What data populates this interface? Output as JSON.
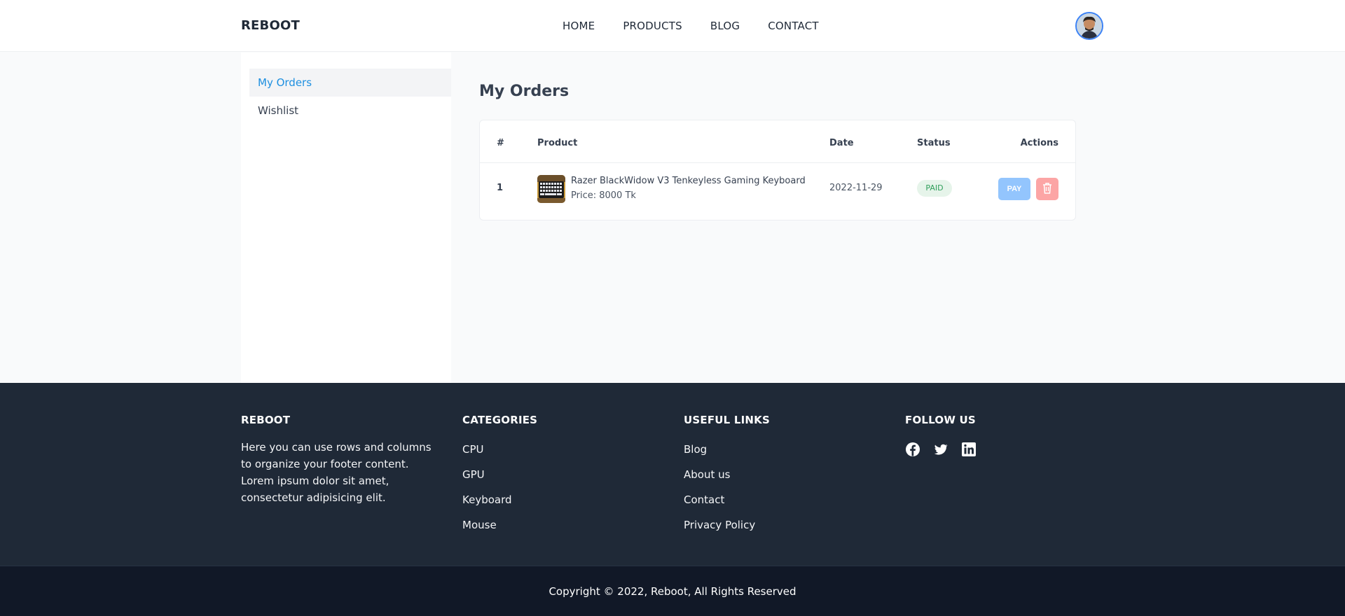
{
  "header": {
    "brand": "REBOOT",
    "nav": [
      "HOME",
      "PRODUCTS",
      "BLOG",
      "CONTACT"
    ]
  },
  "sidebar": {
    "items": [
      {
        "label": "My Orders",
        "active": true
      },
      {
        "label": "Wishlist",
        "active": false
      }
    ]
  },
  "main": {
    "title": "My Orders",
    "table": {
      "headers": [
        "#",
        "Product",
        "Date",
        "Status",
        "Actions"
      ],
      "rows": [
        {
          "index": "1",
          "product_name": "Razer BlackWidow V3 Tenkeyless Gaming Keyboard",
          "price": "Price: 8000 Tk",
          "date": "2022-11-29",
          "status": "PAID",
          "pay_label": "PAY"
        }
      ]
    }
  },
  "footer": {
    "brand": {
      "heading": "REBOOT",
      "text": "Here you can use rows and columns to organize your footer content. Lorem ipsum dolor sit amet, consectetur adipisicing elit."
    },
    "categories": {
      "heading": "CATEGORIES",
      "links": [
        "CPU",
        "GPU",
        "Keyboard",
        "Mouse"
      ]
    },
    "useful_links": {
      "heading": "USEFUL LINKS",
      "links": [
        "Blog",
        "About us",
        "Contact",
        "Privacy Policy"
      ]
    },
    "follow": {
      "heading": "FOLLOW US",
      "icons": [
        "facebook-icon",
        "twitter-icon",
        "linkedin-icon"
      ]
    },
    "copyright": "Copyright © 2022, Reboot, All Rights Reserved"
  },
  "colors": {
    "accent": "#1d8fe0",
    "footer_bg": "#1f2937",
    "copyright_bg": "#111827",
    "paid_badge": "#2f9e5a"
  }
}
